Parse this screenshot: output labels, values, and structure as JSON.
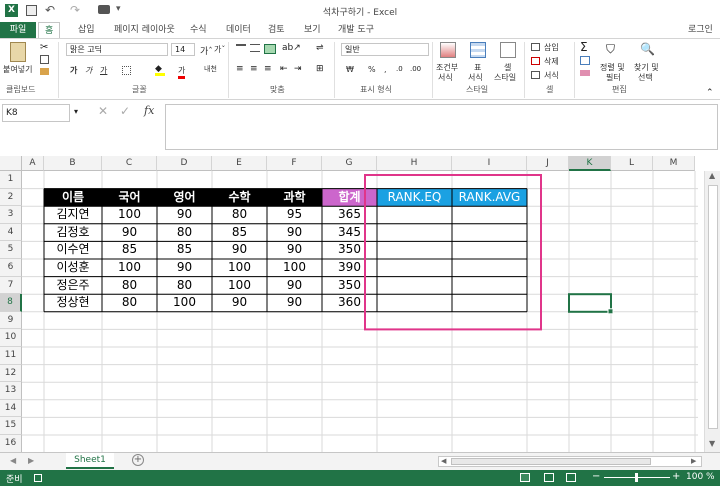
{
  "title": "석차구하기 - Excel",
  "user": "로그인",
  "tabs": [
    "파일",
    "홈",
    "삽입",
    "페이지 레이아웃",
    "수식",
    "데이터",
    "검토",
    "보기",
    "개발 도구"
  ],
  "ribbon": {
    "paste": "붙여넣기",
    "font_name": "맑은 고딕",
    "font_size": "14",
    "number_format": "일반",
    "bold": "가",
    "italic": "가",
    "underline": "가",
    "font_color_glyph": "가",
    "phonetic": "내천",
    "currency": "₩",
    "percent": "%",
    "comma": ",",
    "cond_format_1": "조건부",
    "cond_format_2": "서식",
    "table_format_1": "표",
    "table_format_2": "서식",
    "cell_style_1": "셀",
    "cell_style_2": "스타일",
    "insert": "삽입",
    "delete": "삭제",
    "format": "서식",
    "sort_1": "정렬 및",
    "sort_2": "필터",
    "find_1": "찾기 및",
    "find_2": "선택",
    "groups": [
      "클립보드",
      "글꼴",
      "맞춤",
      "표시 형식",
      "스타일",
      "셀",
      "편집"
    ]
  },
  "name_box": "K8",
  "fx": "fx",
  "columns": [
    "A",
    "B",
    "C",
    "D",
    "E",
    "F",
    "G",
    "H",
    "I",
    "J",
    "K",
    "L",
    "M"
  ],
  "rows": [
    "1",
    "2",
    "3",
    "4",
    "5",
    "6",
    "7",
    "8",
    "9",
    "10",
    "11",
    "12",
    "13",
    "14",
    "15",
    "16"
  ],
  "table": {
    "headers": [
      "이름",
      "국어",
      "영어",
      "수학",
      "과학",
      "합계",
      "RANK.EQ",
      "RANK.AVG"
    ],
    "data": [
      [
        "김지연",
        "100",
        "90",
        "80",
        "95",
        "365"
      ],
      [
        "김정호",
        "90",
        "80",
        "85",
        "90",
        "345"
      ],
      [
        "이수연",
        "85",
        "85",
        "90",
        "90",
        "350"
      ],
      [
        "이성훈",
        "100",
        "90",
        "100",
        "100",
        "390"
      ],
      [
        "정은주",
        "80",
        "80",
        "100",
        "90",
        "350"
      ],
      [
        "정상현",
        "80",
        "100",
        "90",
        "90",
        "360"
      ]
    ]
  },
  "sheet_tab": "Sheet1",
  "status": "준비",
  "zoom": "100 %",
  "colors": {
    "accent": "#217346",
    "header_black": "#000000",
    "sum_header": "#cc66cc",
    "rank_header": "#1ba1e2",
    "highlight_border": "#e0358a"
  }
}
